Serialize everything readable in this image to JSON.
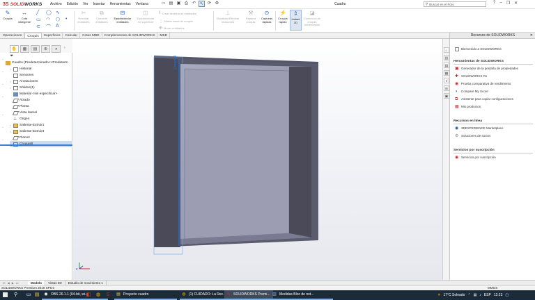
{
  "app": {
    "logo_mark": "3S",
    "logo_red": "SOLID",
    "logo_dark": "WORKS",
    "document_title": "Cuadro",
    "menu": [
      "Archivo",
      "Edición",
      "Ver",
      "Insertar",
      "Herramientas",
      "Ventana"
    ],
    "search_placeholder": "Buscar en el Foro",
    "quick_access_icons": [
      "new-document-icon",
      "open-folder-icon",
      "save-icon",
      "print-icon",
      "undo-icon",
      "select-arrow-icon",
      "rebuild-icon",
      "options-gear-icon"
    ]
  },
  "ribbon": {
    "croquis": "Croquis",
    "cota_inteligente": "Cota inteligente",
    "recortar_entidades": "Recortar entidades",
    "convertir_entidades": "Convertir entidades",
    "equidistanciar_entidades": "Equidistanciar entidades",
    "equidistanciar_superficie": "Equidistanciar en superficie",
    "crear_simetria": "Crear simetría de entidades",
    "matriz_lineal": "Matriz lineal de croquis",
    "mover_entidades": "Mover entidades",
    "visualizar_relaciones": "Visualizar/Eliminar relaciones",
    "reparar_croquis": "Reparar croquis",
    "capturas_rapidas": "Capturas rápidas",
    "croquis_rapido": "Croquis rápido",
    "instant_2d": "Instant 2D",
    "contornos_croquis": "Contornos de croquis sombreados"
  },
  "tabs": [
    "Operaciones",
    "Croquis",
    "Superficies",
    "Calcular",
    "Cotas MBD",
    "Complementos de SOLIDWORKS",
    "MBD"
  ],
  "active_tab": "Croquis",
  "tree": {
    "root": "Cuadro  (Predeterminado<<Predeterm",
    "items": [
      "Historial",
      "Sensores",
      "Anotaciones",
      "Sólidos(1)",
      "Material <sin especificar>",
      "Alzado",
      "Planta",
      "Vista lateral",
      "Origen",
      "Saliente-Extruir1",
      "Saliente-Extruir3",
      "Plano2",
      "Croquis8"
    ]
  },
  "viewport": {
    "sketch_label": "Croquis8"
  },
  "task_pane": {
    "title": "Recursos de SOLIDWORKS",
    "welcome": "Bienvenido a SOLIDWORKS",
    "sec_tools": "Herramientas de SOLIDWORKS",
    "tools": [
      "Generador de la pestaña de propiedades",
      "SOLIDWORKS Rx",
      "Prueba comparativa de rendimiento",
      "Compare My Score",
      "Asistente para copiar configuraciones",
      "Mis productos"
    ],
    "sec_online": "Recursos en línea",
    "online": [
      "3DEXPERIENCE Marketplace",
      "Soluciones de socios"
    ],
    "sec_subs": "Servicios por suscripción",
    "subs": [
      "Servicios por suscripción"
    ]
  },
  "bottom_tabs": [
    "Modelo",
    "Vistas 3D",
    "Estudio de movimiento 1"
  ],
  "status": {
    "left": "SOLIDWORKS Premium 2019 SP5.0",
    "units": "MMGS"
  },
  "taskbar": {
    "apps": [
      "OBS 26.1.1 (64-bit, wi...",
      "Proyecto cuadro",
      "(1) CUIDADO: La Rec...",
      "SOLIDWORKS Premi...",
      "Medidas Bloc de not..."
    ],
    "weather": "17°C  Soleado",
    "lang": "ESP",
    "time": "12:23"
  },
  "colors": {
    "accent": "#2b6cc4",
    "brand": "#d8232a",
    "part_face": "#9c9db2",
    "part_dark": "#4a4a58"
  }
}
